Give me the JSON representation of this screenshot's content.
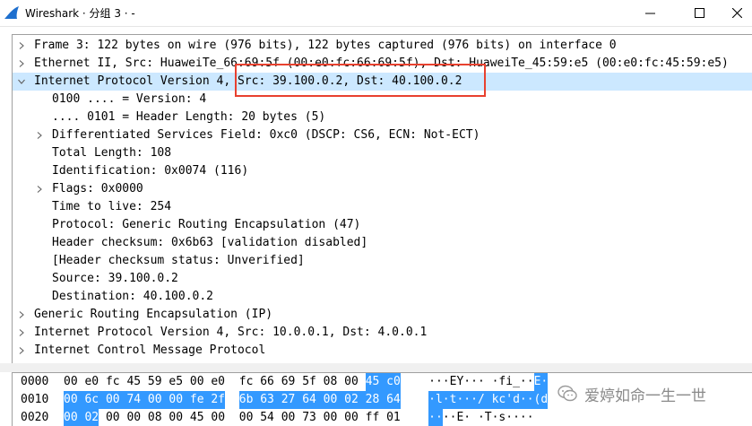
{
  "window": {
    "title": "Wireshark · 分组 3 · -",
    "accent": "#1e6fce"
  },
  "details": {
    "rows": [
      {
        "text": "Frame 3: 122 bytes on wire (976 bits), 122 bytes captured (976 bits) on interface 0",
        "expander": "collapsed",
        "level": 0
      },
      {
        "text": "Ethernet II, Src: HuaweiTe_66:69:5f (00:e0:fc:66:69:5f), Dst: HuaweiTe_45:59:e5 (00:e0:fc:45:59:e5)",
        "expander": "collapsed",
        "level": 0
      },
      {
        "text": "Internet Protocol Version 4, Src: 39.100.0.2, Dst: 40.100.0.2",
        "expander": "expanded",
        "level": 0,
        "selected": true
      },
      {
        "text": "0100 .... = Version: 4",
        "expander": "none",
        "level": 1
      },
      {
        "text": ".... 0101 = Header Length: 20 bytes (5)",
        "expander": "none",
        "level": 1
      },
      {
        "text": "Differentiated Services Field: 0xc0 (DSCP: CS6, ECN: Not-ECT)",
        "expander": "collapsed",
        "level": 1
      },
      {
        "text": "Total Length: 108",
        "expander": "none",
        "level": 1
      },
      {
        "text": "Identification: 0x0074 (116)",
        "expander": "none",
        "level": 1
      },
      {
        "text": "Flags: 0x0000",
        "expander": "collapsed",
        "level": 1
      },
      {
        "text": "Time to live: 254",
        "expander": "none",
        "level": 1
      },
      {
        "text": "Protocol: Generic Routing Encapsulation (47)",
        "expander": "none",
        "level": 1
      },
      {
        "text": "Header checksum: 0x6b63 [validation disabled]",
        "expander": "none",
        "level": 1
      },
      {
        "text": "[Header checksum status: Unverified]",
        "expander": "none",
        "level": 1
      },
      {
        "text": "Source: 39.100.0.2",
        "expander": "none",
        "level": 1
      },
      {
        "text": "Destination: 40.100.0.2",
        "expander": "none",
        "level": 1
      },
      {
        "text": "Generic Routing Encapsulation (IP)",
        "expander": "collapsed",
        "level": 0
      },
      {
        "text": "Internet Protocol Version 4, Src: 10.0.0.1, Dst: 4.0.0.1",
        "expander": "collapsed",
        "level": 0
      },
      {
        "text": "Internet Control Message Protocol",
        "expander": "collapsed",
        "level": 0
      }
    ],
    "highlight_color": "#e8412f",
    "selection_color": "#cce8ff"
  },
  "hex": {
    "rows": [
      {
        "offset": "0000",
        "bytes_a": "00 e0 fc 45 59 e5 00 e0",
        "bytes_b": "fc 66 69 5f 08 00",
        "bytes_b_hl": "45 c0",
        "ascii": "···EY··· ·fi_··",
        "ascii_hl": "E·"
      },
      {
        "offset": "0010",
        "bytes_a_hl": "00 6c 00 74 00 00 fe 2f",
        "bytes_b_hl": "6b 63 27 64 00 02 28 64",
        "ascii_hl": "·l·t···/ kc'd··(d"
      },
      {
        "offset": "0020",
        "bytes_a_hl": "00 02",
        "bytes_a": "00 00 08 00 45 00",
        "bytes_b": "00 54 00 73 00 00 ff 01",
        "ascii_hl": "··",
        "ascii": "··E· ·T·s····"
      }
    ],
    "highlight_color": "#3399ff"
  },
  "watermark": {
    "text": "爱婷如命一生一世"
  }
}
